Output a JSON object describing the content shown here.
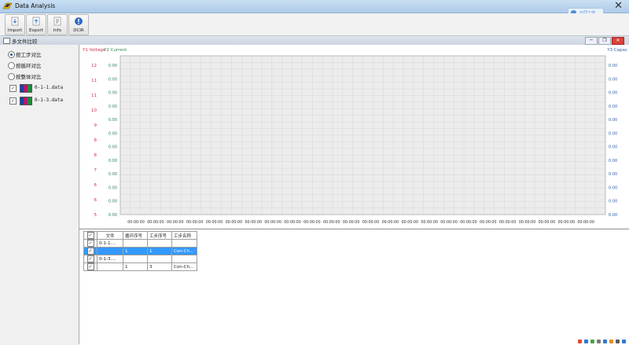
{
  "window": {
    "title": "Data Analysis",
    "close": "✕"
  },
  "cloud": {
    "label": "云同工作"
  },
  "toolbar": {
    "items": [
      {
        "label": "Import",
        "icon": "import-icon"
      },
      {
        "label": "Export",
        "icon": "export-icon"
      },
      {
        "label": "Info",
        "icon": "info-icon"
      },
      {
        "label": "DCIR",
        "icon": "dcir-icon"
      }
    ]
  },
  "subwindow": {
    "title": "多文件比较",
    "min": "─",
    "restore": "❐",
    "close": "✕"
  },
  "left_panel": {
    "options": [
      {
        "label": "按工步对比",
        "checked": true
      },
      {
        "label": "按循环对比",
        "checked": false
      },
      {
        "label": "按整体对比",
        "checked": false
      }
    ],
    "files": [
      {
        "name": "0-1-1.data",
        "checked": true
      },
      {
        "name": "0-1-3.data",
        "checked": true
      }
    ]
  },
  "chart_data": {
    "type": "line",
    "legend": {
      "y1": "Y1 Voltage",
      "y2": "Y2 Current",
      "y3": "Y3 Capac"
    },
    "y1_ticks": [
      "12",
      "11",
      "11",
      "10",
      "9",
      "8",
      "8",
      "7",
      "6",
      "6",
      "5"
    ],
    "y2_ticks": [
      "0.00",
      "0.00",
      "0.00",
      "0.00",
      "0.00",
      "0.00",
      "0.00",
      "0.00",
      "0.00",
      "0.00",
      "0.00",
      "0.00"
    ],
    "y3_ticks": [
      "0.00",
      "0.00",
      "0.00",
      "0.00",
      "0.00",
      "0.00",
      "0.00",
      "0.00",
      "0.00",
      "0.00",
      "0.00",
      "0.00"
    ],
    "x_ticks": [
      "00:00:00",
      "00:00:00",
      "00:00:00",
      "00:00:00",
      "00:00:00",
      "00:00:00",
      "00:00:00",
      "00:00:00",
      "00:00:00",
      "00:00:00",
      "00:00:00",
      "00:00:00",
      "00:00:00",
      "00:00:00",
      "00:00:00",
      "00:00:00",
      "00:00:00",
      "00:00:00",
      "00:00:00",
      "00:00:00",
      "00:00:00",
      "00:00:00",
      "00:00:00",
      "00:00:00"
    ],
    "series": [],
    "grid": true
  },
  "table": {
    "headers": [
      "",
      "文件",
      "循环序号",
      "工步序号",
      "工步名称"
    ],
    "rows": [
      {
        "checked": true,
        "cells": [
          "0-1-1....",
          "",
          "",
          ""
        ],
        "selected": false
      },
      {
        "checked": true,
        "cells": [
          "",
          "1",
          "1",
          "Con-Ch..."
        ],
        "selected": true
      },
      {
        "checked": true,
        "cells": [
          "0-1-3....",
          "",
          "",
          ""
        ],
        "selected": false
      },
      {
        "checked": true,
        "cells": [
          "",
          "1",
          "3",
          "Con-Ch..."
        ],
        "selected": false
      }
    ]
  },
  "tray": {
    "colors": [
      "#e34b2b",
      "#2f7ad6",
      "#47a447",
      "#7b7b7b",
      "#2f7ad6",
      "#e38b2b",
      "#5d5d5d",
      "#2f7ad6"
    ]
  }
}
